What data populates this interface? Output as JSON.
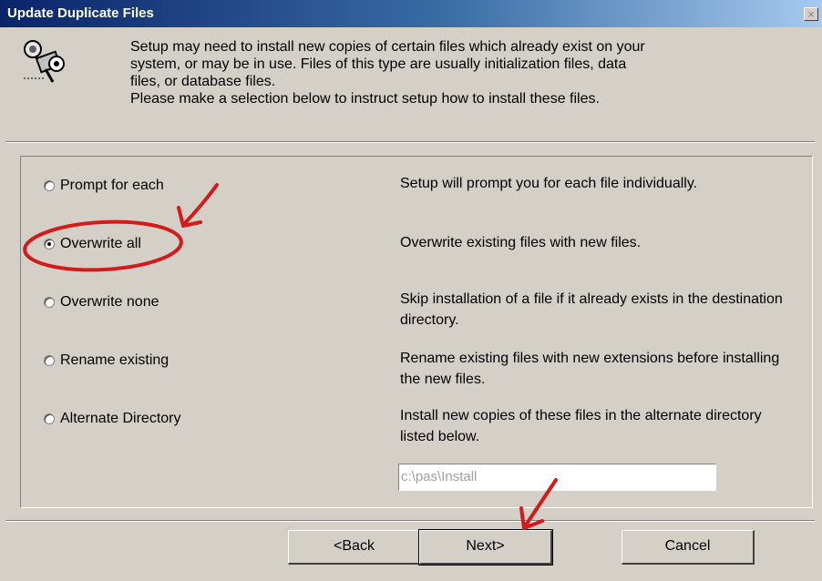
{
  "window": {
    "title": "Update Duplicate Files",
    "close_glyph": "×"
  },
  "header": {
    "icon": "setup-files-icon",
    "lines": [
      "Setup may need to install new copies of certain files which already exist on your",
      "system, or may be in use.  Files of this type are usually initialization files, data",
      "files, or database files.",
      "Please make a selection below to instruct setup how to install these files."
    ]
  },
  "options": [
    {
      "label": "Prompt for each",
      "selected": false,
      "description": "Setup will prompt you for each file individually."
    },
    {
      "label": "Overwrite all",
      "selected": true,
      "description": "Overwrite existing files with new files."
    },
    {
      "label": "Overwrite none",
      "selected": false,
      "description": "Skip installation of a file if it already exists in the destination directory."
    },
    {
      "label": "Rename existing",
      "selected": false,
      "description": "Rename existing files with new extensions before installing the new files."
    },
    {
      "label": "Alternate Directory",
      "selected": false,
      "description": "Install new copies of these files in the alternate directory listed below."
    }
  ],
  "alternate_directory": {
    "value": "c:\\pas\\Install"
  },
  "buttons": {
    "back": "<Back",
    "next": "Next>",
    "cancel": "Cancel"
  },
  "annotations": {
    "color": "#d41a1a",
    "highlight": "Overwrite all"
  }
}
